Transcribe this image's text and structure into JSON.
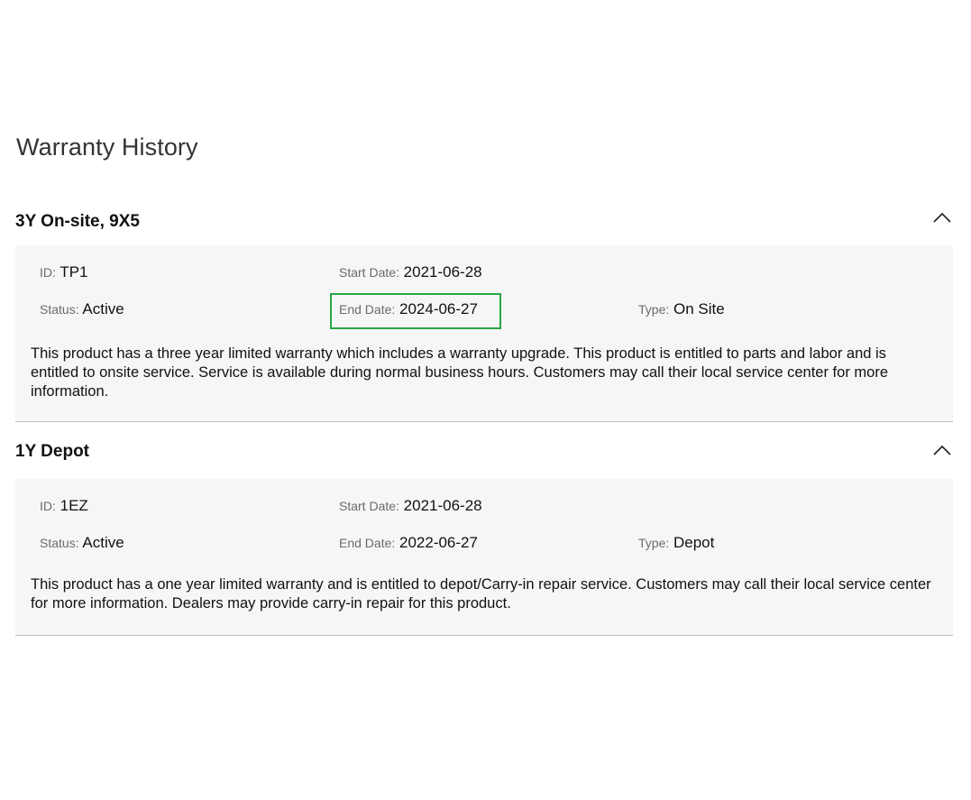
{
  "page": {
    "title": "Warranty History"
  },
  "labels": {
    "id": "ID",
    "start_date": "Start Date",
    "end_date": "End Date",
    "status": "Status",
    "type": "Type",
    "separator": ":"
  },
  "warranties": [
    {
      "name": "3Y On-site, 9X5",
      "id": "TP1",
      "start_date": "2021-06-28",
      "end_date": "2024-06-27",
      "status": "Active",
      "type": "On Site",
      "description": "This product has a three year limited warranty which includes a warranty upgrade. This product is entitled to parts and labor and is entitled to onsite service. Service is available during normal business hours. Customers may call their local service center for more information.",
      "expanded": true,
      "end_date_highlighted": true
    },
    {
      "name": "1Y Depot",
      "id": "1EZ",
      "start_date": "2021-06-28",
      "end_date": "2022-06-27",
      "status": "Active",
      "type": "Depot",
      "description": "This product has a one year limited warranty and is entitled to depot/Carry-in repair service. Customers may call their local service center for more information. Dealers may provide carry-in repair for this product.",
      "expanded": true,
      "end_date_highlighted": false
    }
  ],
  "colors": {
    "highlight_border": "#28a745",
    "panel_background": "#f6f6f6",
    "label_text": "#6b6b6b"
  },
  "icons": {
    "collapse": "chevron-up-icon"
  }
}
